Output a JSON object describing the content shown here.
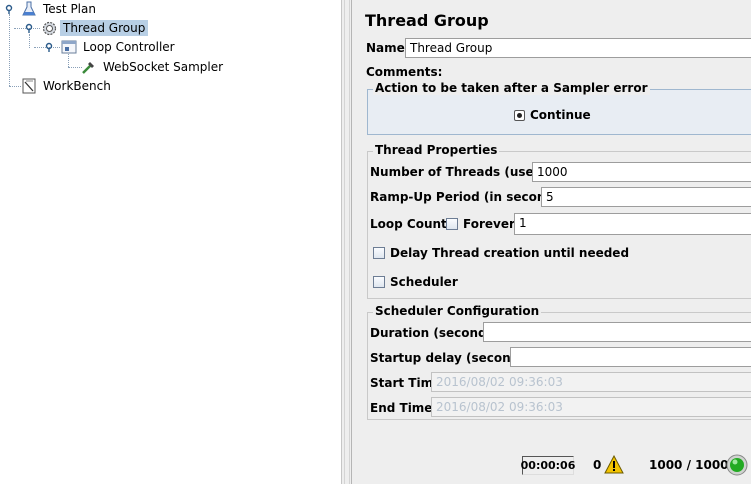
{
  "tree": {
    "items": [
      {
        "label": "Test Plan",
        "icon": "test-plan-flask-icon"
      },
      {
        "label": "Thread Group",
        "icon": "thread-group-gear-icon",
        "selected": true
      },
      {
        "label": "Loop Controller",
        "icon": "loop-controller-icon"
      },
      {
        "label": "WebSocket Sampler",
        "icon": "websocket-sampler-pipette-icon"
      },
      {
        "label": "WorkBench",
        "icon": "workbench-icon"
      }
    ]
  },
  "panel": {
    "title": "Thread Group",
    "name_label": "Name:",
    "name_value": "Thread Group",
    "comments_label": "Comments:",
    "error_action": {
      "legend": "Action to be taken after a Sampler error",
      "selected_option": "Continue"
    },
    "thread_props": {
      "legend": "Thread Properties",
      "threads_label": "Number of Threads (users):",
      "threads_value": "1000",
      "rampup_label": "Ramp-Up Period (in seconds):",
      "rampup_value": "5",
      "loop_label": "Loop Count:",
      "forever_label": "Forever",
      "loop_value": "1",
      "delay_label": "Delay Thread creation until needed",
      "scheduler_label": "Scheduler"
    },
    "scheduler_config": {
      "legend": "Scheduler Configuration",
      "duration_label": "Duration (seconds)",
      "duration_value": "",
      "startup_label": "Startup delay (seconds)",
      "startup_value": "",
      "start_label": "Start Time",
      "start_value": "2016/08/02 09:36:03",
      "end_label": "End Time",
      "end_value": "2016/08/02 09:36:03"
    }
  },
  "status": {
    "elapsed": "00:00:06",
    "warnings": "0",
    "threads": "1000 / 1000",
    "warning_icon": "warning-triangle-icon",
    "run_icon": "running-green-light-icon",
    "run_color": "#22aa22",
    "warning_color": "#f2c300"
  }
}
